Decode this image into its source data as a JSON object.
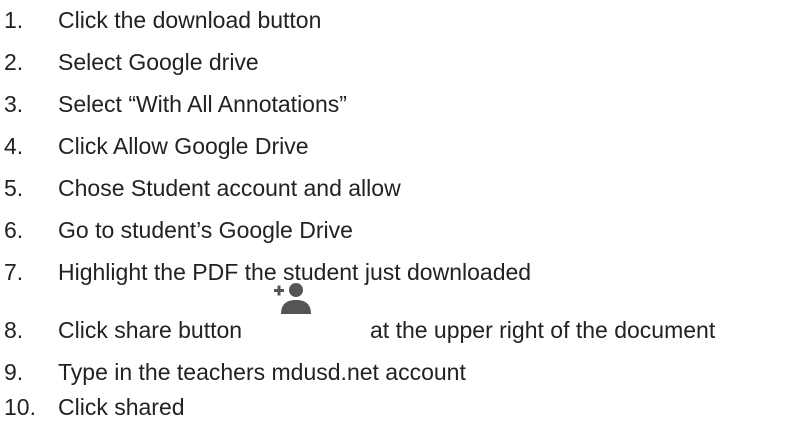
{
  "steps": [
    {
      "number": "1.",
      "text": "Click the download button"
    },
    {
      "number": "2.",
      "text": "Select Google drive"
    },
    {
      "number": "3.",
      "text": "Select “With All Annotations”"
    },
    {
      "number": "4.",
      "text": "Click Allow Google Drive"
    },
    {
      "number": "5.",
      "text": "Chose Student account and allow"
    },
    {
      "number": "6.",
      "text": "Go to student’s Google Drive"
    },
    {
      "number": "7.",
      "text": "Highlight the PDF the student just downloaded"
    },
    {
      "number": "8.",
      "text": "Click share button",
      "after_icon": "at the upper right of the document",
      "icon": "add-person-icon"
    },
    {
      "number": "9.",
      "text": "Type in the teachers mdusd.net account"
    },
    {
      "number": "10.",
      "text": "Click shared"
    }
  ],
  "colors": {
    "text": "#222222",
    "icon": "#555555"
  }
}
